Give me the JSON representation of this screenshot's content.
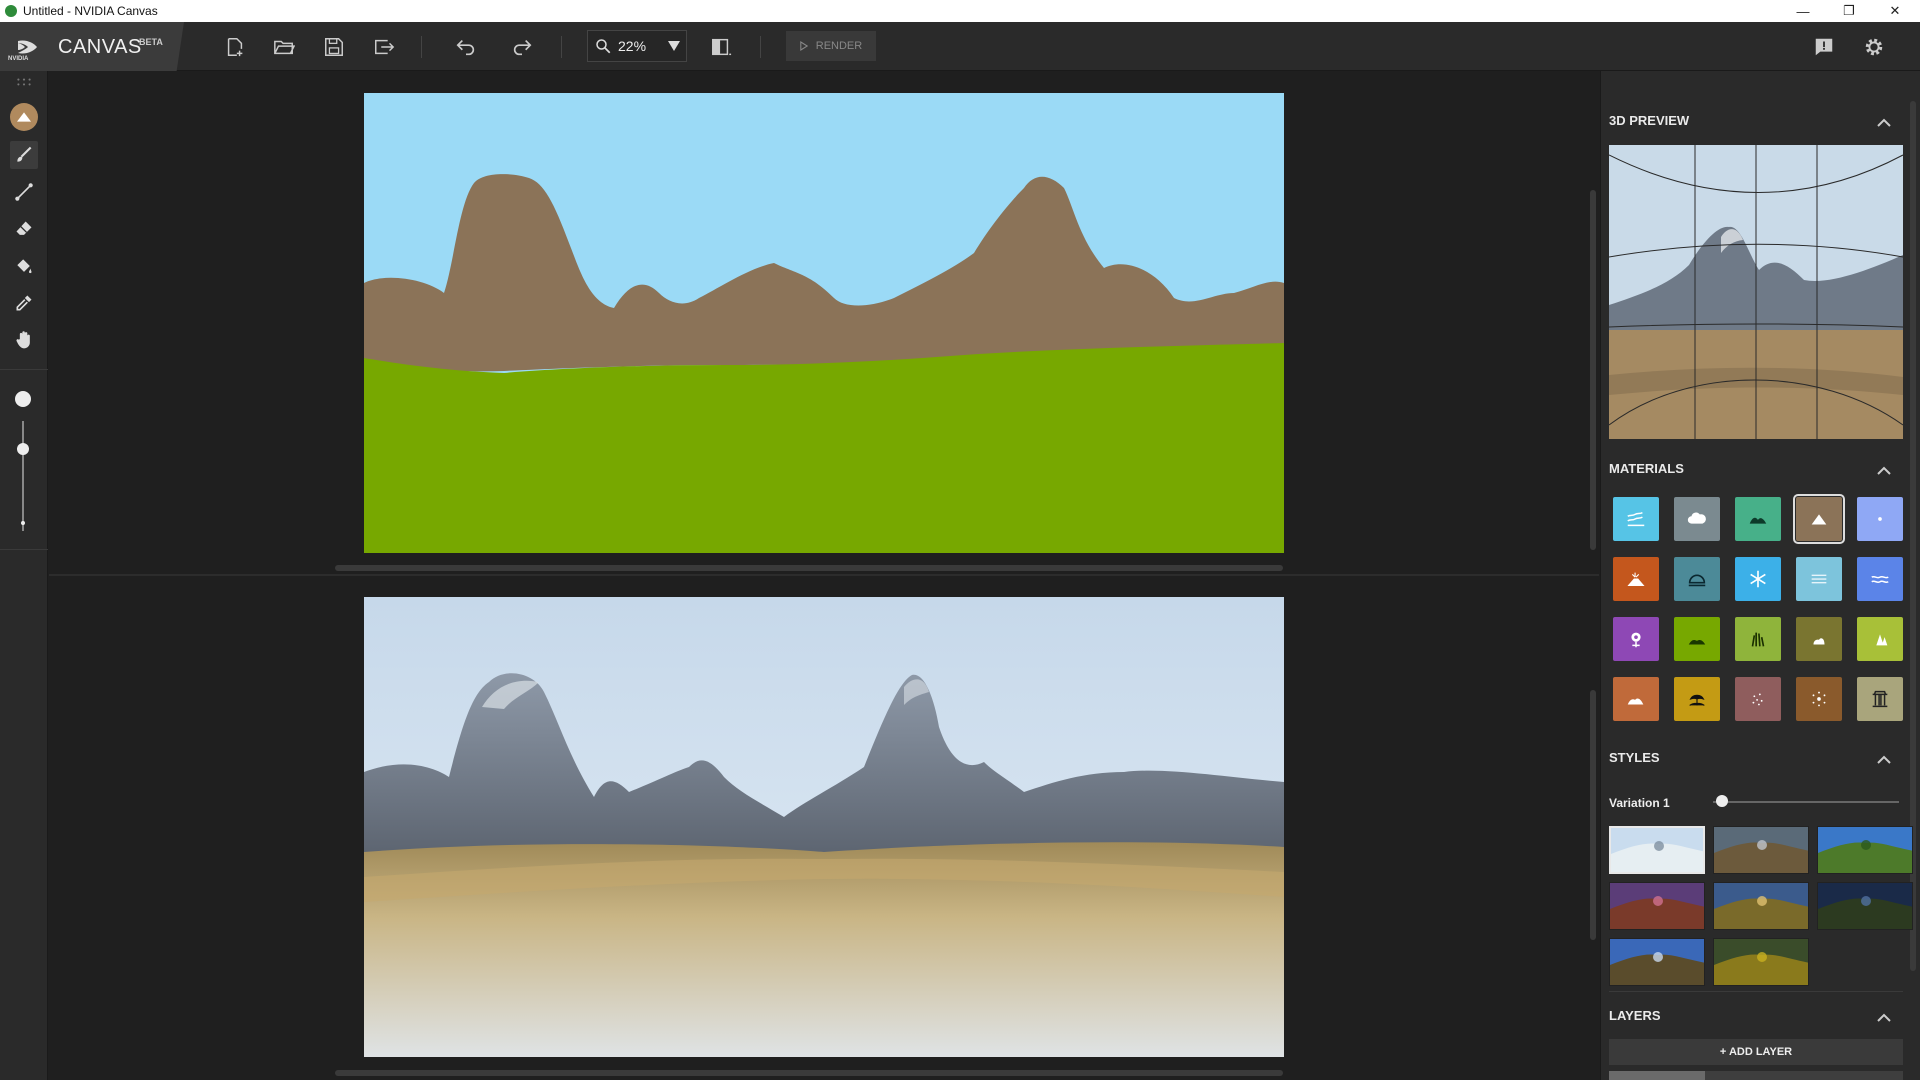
{
  "window": {
    "title": "Untitled - NVIDIA Canvas",
    "controls": [
      "minimize-icon",
      "restore-icon",
      "close-icon"
    ]
  },
  "brand": {
    "logo_text": "NVIDIA",
    "name": "CANVAS",
    "badge": "BETA"
  },
  "toolbar": {
    "buttons": [
      "new-file-icon",
      "open-folder-icon",
      "save-icon",
      "export-icon",
      "undo-icon",
      "redo-icon",
      "compare-icon"
    ],
    "zoom_value": "22%",
    "render_label": "RENDER",
    "right_buttons": [
      "feedback-icon",
      "gear-icon"
    ]
  },
  "left_tools": [
    "drag-handle-icon",
    "material-mountain-icon",
    "brush-icon",
    "line-icon",
    "eraser-icon",
    "fill-bucket-icon",
    "eyedropper-icon",
    "hand-pan-icon"
  ],
  "brush_size": {
    "level": 0.75
  },
  "colors": {
    "sky": "#9bdaf6",
    "mountain": "#8b7358",
    "grass": "#77a800",
    "panel": "#2a2a2a",
    "accent_selected": "#b08a5e"
  },
  "right_panel": {
    "preview_title": "3D PREVIEW",
    "materials_title": "MATERIALS",
    "styles_title": "STYLES",
    "layers_title": "LAYERS",
    "variation_label": "Variation 1",
    "variation_value": 0.05,
    "add_layer_label": "+ ADD LAYER"
  },
  "materials": [
    {
      "icon": "water-icon",
      "color": "#56c4e6"
    },
    {
      "icon": "cloud-icon",
      "color": "#7b8a90"
    },
    {
      "icon": "hill-icon",
      "color": "#47b089"
    },
    {
      "icon": "mountain-icon",
      "color": "#8b7358",
      "selected": true
    },
    {
      "icon": "sky-icon",
      "color": "#8fa8f5"
    },
    {
      "icon": "volcano-icon",
      "color": "#c4571d"
    },
    {
      "icon": "stone-icon",
      "color": "#4c8a98"
    },
    {
      "icon": "snow-icon",
      "color": "#3cb0e8"
    },
    {
      "icon": "fog-icon",
      "color": "#7dc4dc"
    },
    {
      "icon": "sea-icon",
      "color": "#5b84e8"
    },
    {
      "icon": "flower-icon",
      "color": "#8e48b5"
    },
    {
      "icon": "grass-icon",
      "color": "#77a800"
    },
    {
      "icon": "reeds-icon",
      "color": "#8fb43b"
    },
    {
      "icon": "bush-icon",
      "color": "#7a7530"
    },
    {
      "icon": "tree-icon",
      "color": "#a8c038"
    },
    {
      "icon": "dirt-icon",
      "color": "#c06a3a"
    },
    {
      "icon": "sand-icon",
      "color": "#c49b14"
    },
    {
      "icon": "gravel-icon",
      "color": "#8f5d5d"
    },
    {
      "icon": "rock-icon",
      "color": "#8a5a2c"
    },
    {
      "icon": "building-icon",
      "color": "#a9a57c"
    }
  ],
  "styles": [
    {
      "sky": "#c9dcee",
      "ground": "#e6eef2",
      "accent": "#8090a0",
      "selected": true
    },
    {
      "sky": "#5a6a78",
      "ground": "#6c5a3c",
      "accent": "#c0c4cc"
    },
    {
      "sky": "#3a78c8",
      "ground": "#4d7a2a",
      "accent": "#2c5a1c"
    },
    {
      "sky": "#5b3d78",
      "ground": "#7a3a2a",
      "accent": "#d07090"
    },
    {
      "sky": "#3b5b8c",
      "ground": "#7a6a2a",
      "accent": "#e0c070"
    },
    {
      "sky": "#1a2a48",
      "ground": "#2c3a20",
      "accent": "#5070a0"
    },
    {
      "sky": "#3a68b8",
      "ground": "#5a4c2c",
      "accent": "#c8d8ee"
    },
    {
      "sky": "#3a4c2a",
      "ground": "#8a7a1c",
      "accent": "#c8b020"
    }
  ]
}
